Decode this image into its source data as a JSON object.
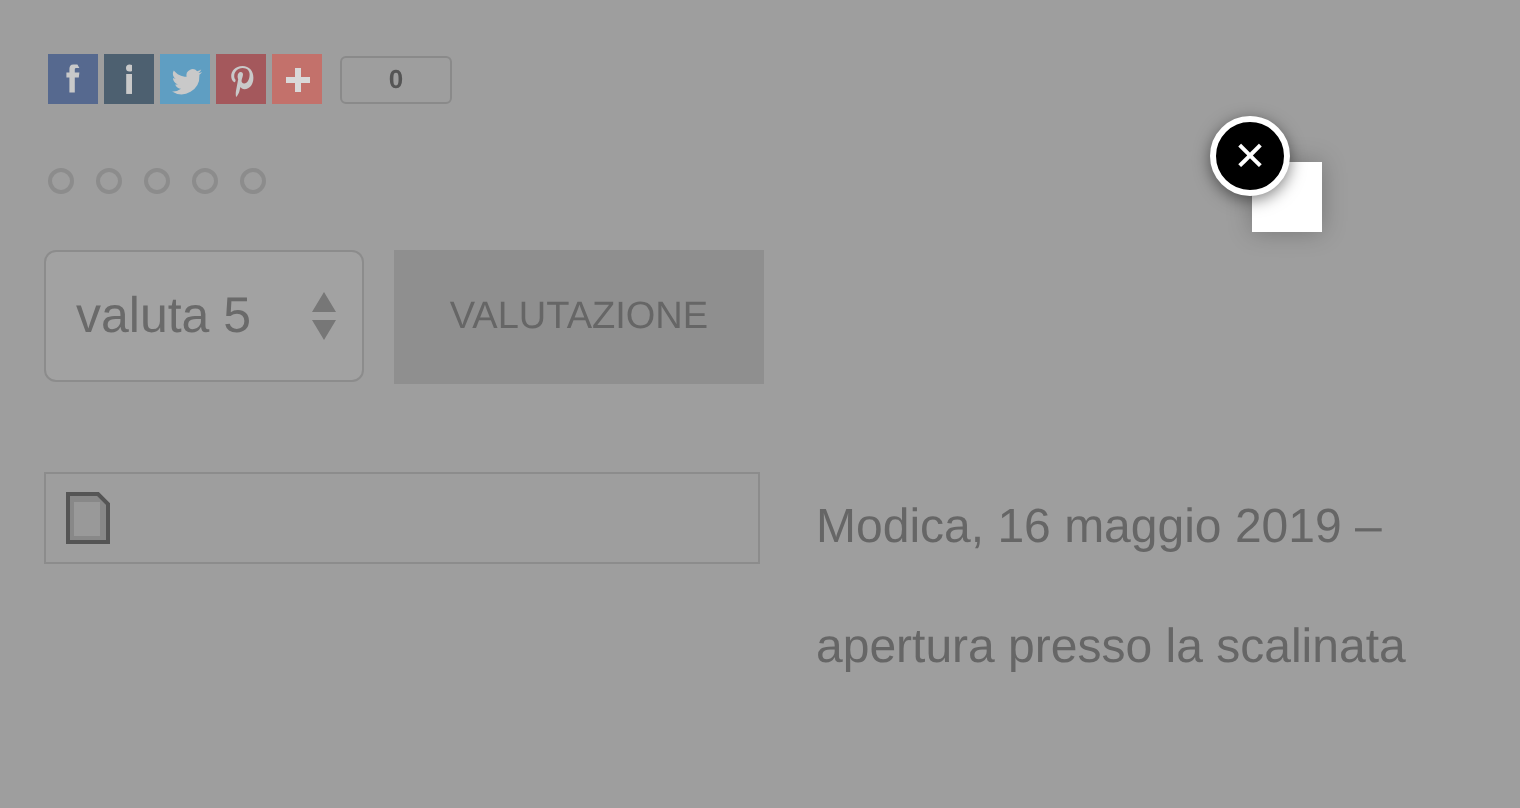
{
  "share_bar": {
    "buttons": [
      {
        "kind": "facebook",
        "color": "#56698f"
      },
      {
        "kind": "info",
        "color": "#4d6070"
      },
      {
        "kind": "twitter",
        "color": "#5f9ec2"
      },
      {
        "kind": "pinterest",
        "color": "#a4585c"
      },
      {
        "kind": "plus",
        "color": "#c3716b"
      }
    ],
    "count": "0"
  },
  "rating": {
    "options": [
      {
        "selected": false
      },
      {
        "selected": false
      },
      {
        "selected": false
      },
      {
        "selected": false
      },
      {
        "selected": false
      }
    ]
  },
  "rating_form": {
    "select_value": "valuta 5",
    "button": "VALUTAZIONE"
  },
  "article": {
    "lines": [
      "Modica, 16 maggio 2019 –",
      "apertura presso la scalinata"
    ]
  },
  "lightbox": {
    "close": "✕"
  }
}
